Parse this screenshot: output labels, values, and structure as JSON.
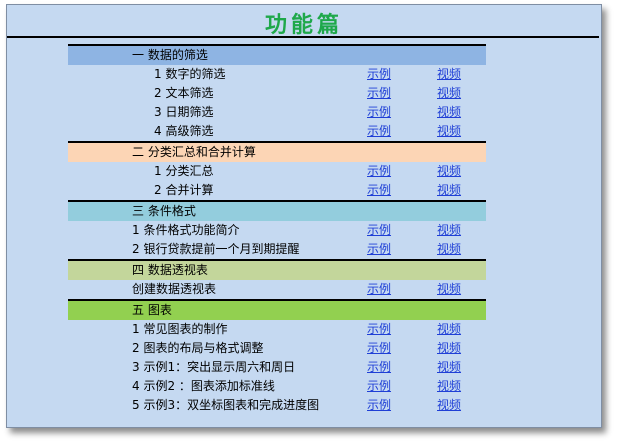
{
  "title": "功能篇",
  "example_label": "示例",
  "video_label": "视频",
  "sections": [
    {
      "heading": "一  数据的筛选",
      "color": "#8eb4e3",
      "items": [
        "1 数字的筛选",
        "2 文本筛选",
        "3 日期筛选",
        "4 高级筛选"
      ]
    },
    {
      "heading": "二  分类汇总和合并计算",
      "color": "#fcd5b5",
      "items": [
        "1 分类汇总",
        "2 合并计算"
      ]
    },
    {
      "heading": "三  条件格式",
      "color": "#93cddd",
      "items": [
        "1 条件格式功能简介",
        "2 银行贷款提前一个月到期提醒"
      ]
    },
    {
      "heading": "四  数据透视表",
      "color": "#c3d69b",
      "items": [
        "创建数据透视表"
      ]
    },
    {
      "heading": "五  图表",
      "color": "#92d050",
      "items": [
        "1 常见图表的制作",
        "2 图表的布局与格式调整",
        "3 示例1：突出显示周六和周日",
        "4 示例2 ：图表添加标准线",
        "5 示例3：双坐标图表和完成进度图"
      ]
    }
  ]
}
